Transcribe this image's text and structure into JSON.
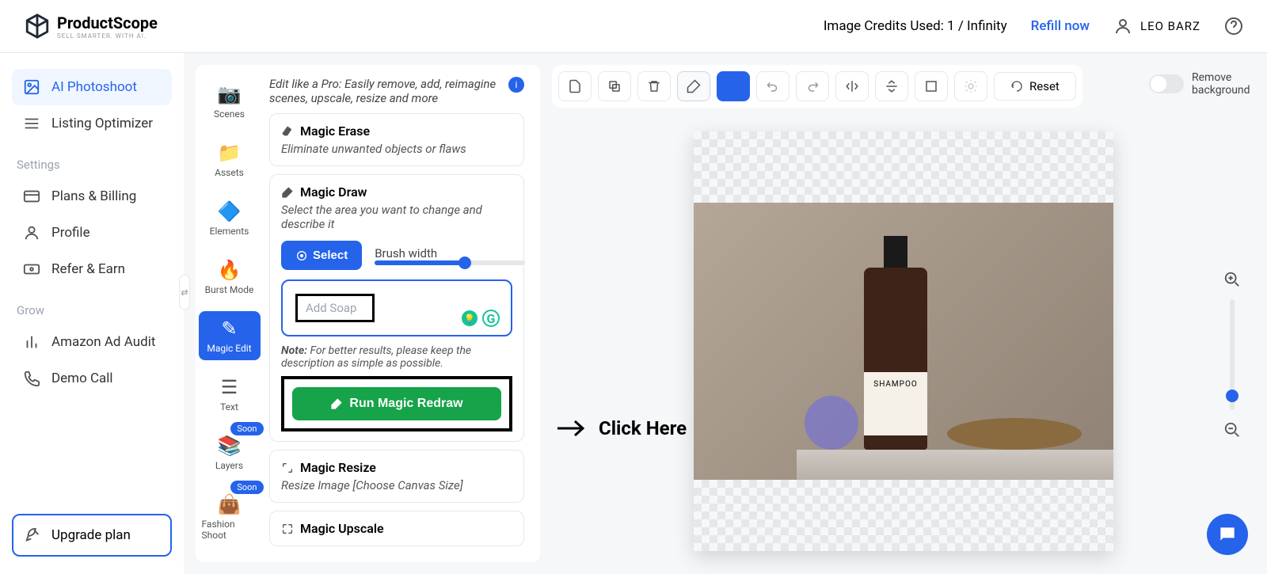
{
  "brand": {
    "name": "ProductScope",
    "tagline": "SELL SMARTER. WITH AI."
  },
  "header": {
    "credits": "Image Credits Used: 1 / Infinity",
    "refill": "Refill now",
    "user": "LEO BARZ"
  },
  "sidebar": {
    "nav": [
      "AI Photoshoot",
      "Listing Optimizer"
    ],
    "settings_label": "Settings",
    "settings": [
      "Plans & Billing",
      "Profile",
      "Refer & Earn"
    ],
    "grow_label": "Grow",
    "grow": [
      "Amazon Ad Audit",
      "Demo Call"
    ],
    "upgrade": "Upgrade plan"
  },
  "rail": {
    "items": [
      "Scenes",
      "Assets",
      "Elements",
      "Burst Mode",
      "Magic Edit",
      "Text",
      "Layers",
      "Fashion Shoot"
    ],
    "soon": "Soon"
  },
  "panel": {
    "intro": "Edit like a Pro: Easily remove, add, reimagine scenes, upscale, resize and more",
    "erase_title": "Magic Erase",
    "erase_desc": "Eliminate unwanted objects or flaws",
    "draw_title": "Magic Draw",
    "draw_desc": "Select the area you want to change and describe it",
    "select_btn": "Select",
    "brush_label": "Brush width",
    "prompt_placeholder": "Add Soap",
    "note_label": "Note:",
    "note_text": " For better results, please keep the description as simple as possible.",
    "run_btn": "Run Magic Redraw",
    "resize_title": "Magic Resize",
    "resize_desc": "Resize Image [Choose Canvas Size]",
    "upscale_title": "Magic Upscale"
  },
  "canvas": {
    "reset": "Reset",
    "remove_bg": "Remove background",
    "product_label": "SHAMPOO"
  },
  "annotation": {
    "click_here": "Click Here"
  }
}
